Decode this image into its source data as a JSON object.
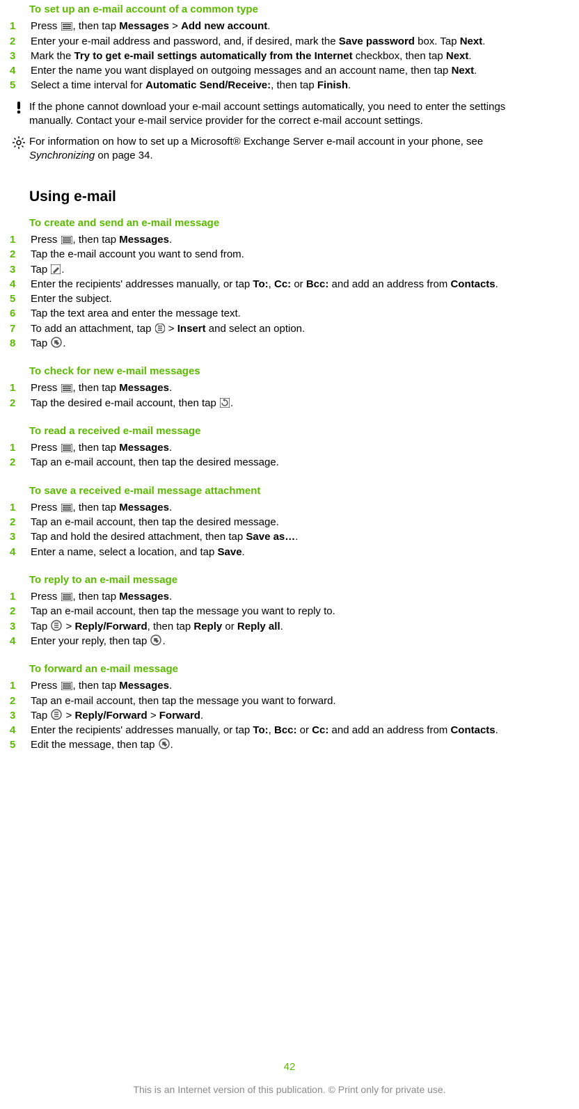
{
  "accent_color": "#5bba00",
  "icons": {
    "menu": "menu-icon",
    "compose": "compose-icon",
    "attach": "attach-icon",
    "send": "send-icon",
    "refresh": "refresh-icon",
    "options": "options-icon",
    "warn": "warn-icon",
    "tip": "tip-icon"
  },
  "sections": {
    "setup": {
      "title": "To set up an e-mail account of a common type",
      "steps": {
        "1": {
          "a": "Press ",
          "b": ", then tap ",
          "msgs": "Messages",
          "gt": " > ",
          "add": "Add new account",
          "end": "."
        },
        "2": {
          "a": "Enter your e-mail address and password, and, if desired, mark the ",
          "save": "Save password",
          "b": " box. Tap ",
          "next": "Next",
          "end": "."
        },
        "3": {
          "a": "Mark the ",
          "try": "Try to get e-mail settings automatically from the Internet",
          "b": " checkbox, then tap ",
          "next": "Next",
          "end": "."
        },
        "4": {
          "a": "Enter the name you want displayed on outgoing messages and an account name, then tap ",
          "next": "Next",
          "end": "."
        },
        "5": {
          "a": "Select a time interval for ",
          "asr": "Automatic Send/Receive:",
          "b": ", then tap ",
          "fin": "Finish",
          "end": "."
        }
      },
      "warn": "If the phone cannot download your e-mail account settings automatically, you need to enter the settings manually. Contact your e-mail service provider for the correct e-mail account settings.",
      "tip": {
        "a": "For information on how to set up a Microsoft® Exchange Server e-mail account in your phone, see ",
        "ref": "Synchronizing",
        "b": " on page 34."
      }
    },
    "using_heading": "Using e-mail",
    "create": {
      "title": "To create and send an e-mail message",
      "steps": {
        "1": {
          "a": "Press ",
          "b": ", then tap ",
          "msgs": "Messages",
          "end": "."
        },
        "2": "Tap the e-mail account you want to send from.",
        "3": {
          "a": "Tap ",
          "end": "."
        },
        "4": {
          "a": "Enter the recipients' addresses manually, or tap ",
          "to": "To:",
          "b": ", ",
          "cc": "Cc:",
          "c": " or ",
          "bcc": "Bcc:",
          "d": " and add an address from ",
          "contacts": "Contacts",
          "end": "."
        },
        "5": "Enter the subject.",
        "6": "Tap the text area and enter the message text.",
        "7": {
          "a": "To add an attachment, tap ",
          "gt": " > ",
          "ins": "Insert",
          "b": " and select an option."
        },
        "8": {
          "a": "Tap ",
          "end": "."
        }
      }
    },
    "check": {
      "title": "To check for new e-mail messages",
      "steps": {
        "1": {
          "a": "Press ",
          "b": ", then tap ",
          "msgs": "Messages",
          "end": "."
        },
        "2": {
          "a": "Tap the desired e-mail account, then tap ",
          "end": "."
        }
      }
    },
    "read": {
      "title": "To read a received e-mail message",
      "steps": {
        "1": {
          "a": "Press ",
          "b": ", then tap ",
          "msgs": "Messages",
          "end": "."
        },
        "2": "Tap an e-mail account, then tap the desired message."
      }
    },
    "save": {
      "title": "To save a received e-mail message attachment",
      "steps": {
        "1": {
          "a": "Press ",
          "b": ", then tap ",
          "msgs": "Messages",
          "end": "."
        },
        "2": "Tap an e-mail account, then tap the desired message.",
        "3": {
          "a": "Tap and hold the desired attachment, then tap ",
          "save": "Save as…",
          "end": "."
        },
        "4": {
          "a": "Enter a name, select a location, and tap ",
          "save": "Save",
          "end": "."
        }
      }
    },
    "reply": {
      "title": "To reply to an e-mail message",
      "steps": {
        "1": {
          "a": "Press ",
          "b": ", then tap ",
          "msgs": "Messages",
          "end": "."
        },
        "2": "Tap an e-mail account, then tap the message you want to reply to.",
        "3": {
          "a": "Tap ",
          "gt": " > ",
          "rf": "Reply/Forward",
          "b": ", then tap ",
          "r": "Reply",
          "c": " or ",
          "ra": "Reply all",
          "end": "."
        },
        "4": {
          "a": "Enter your reply, then tap ",
          "end": "."
        }
      }
    },
    "forward": {
      "title": "To forward an e-mail message",
      "steps": {
        "1": {
          "a": "Press ",
          "b": ", then tap ",
          "msgs": "Messages",
          "end": "."
        },
        "2": "Tap an e-mail account, then tap the message you want to forward.",
        "3": {
          "a": "Tap ",
          "gt": " > ",
          "rf": "Reply/Forward",
          "gt2": " > ",
          "fw": "Forward",
          "end": "."
        },
        "4": {
          "a": "Enter the recipients' addresses manually, or tap ",
          "to": "To:",
          "b": ", ",
          "bcc": "Bcc:",
          "c": " or ",
          "cc": "Cc:",
          "d": " and add an address from ",
          "contacts": "Contacts",
          "end": "."
        },
        "5": {
          "a": "Edit the message, then tap ",
          "end": "."
        }
      }
    }
  },
  "page_number": "42",
  "footer": "This is an Internet version of this publication. © Print only for private use."
}
